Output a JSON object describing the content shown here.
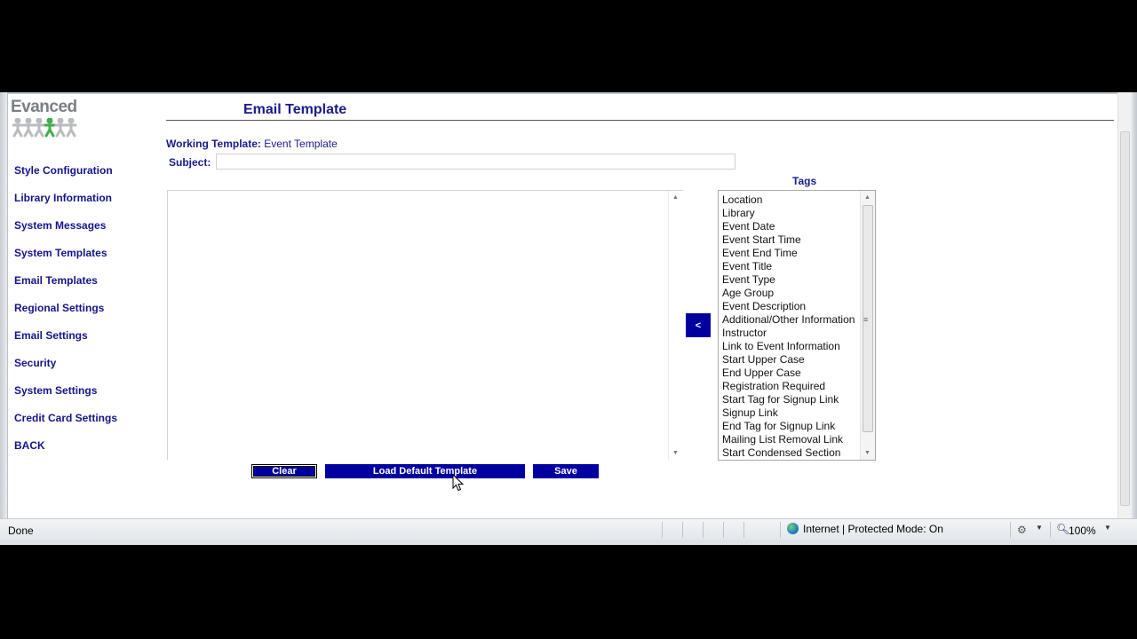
{
  "logo": {
    "text": "Evanced"
  },
  "sidebar": {
    "items": [
      {
        "label": "Style Configuration"
      },
      {
        "label": "Library Information"
      },
      {
        "label": "System Messages"
      },
      {
        "label": "System Templates"
      },
      {
        "label": "Email Templates"
      },
      {
        "label": "Regional Settings"
      },
      {
        "label": "Email Settings"
      },
      {
        "label": "Security"
      },
      {
        "label": "System Settings"
      },
      {
        "label": "Credit Card Settings"
      },
      {
        "label": "BACK"
      }
    ]
  },
  "header": {
    "title": "Email Template"
  },
  "form": {
    "working_template_label": "Working Template:",
    "working_template_value": "Event Template",
    "subject_label": "Subject:",
    "subject_value": "",
    "body_value": ""
  },
  "insert_button": {
    "label": "<"
  },
  "tags": {
    "label": "Tags",
    "items": [
      "Location",
      "Library",
      "Event Date",
      "Event Start Time",
      "Event End Time",
      "Event Title",
      "Event Type",
      "Age Group",
      "Event Description",
      "Additional/Other Information",
      "Instructor",
      "Link to Event Information",
      "Start Upper Case",
      "End Upper Case",
      "Registration Required",
      "Start Tag for Signup Link",
      "Signup Link",
      "End Tag for Signup Link",
      "Mailing List Removal Link",
      "Start Condensed Section"
    ]
  },
  "buttons": {
    "clear": "Clear",
    "load_default": "Load Default Template",
    "save": "Save"
  },
  "status_bar": {
    "status": "Done",
    "zone": "Internet | Protected Mode: On",
    "zoom": "100%"
  },
  "colors": {
    "nav_text": "#14148c",
    "button_bg": "#0000a0",
    "button_text": "#ffffff"
  }
}
